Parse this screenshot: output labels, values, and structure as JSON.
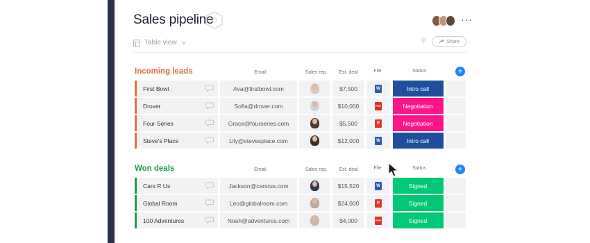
{
  "board": {
    "title": "Sales pipeline",
    "view_label": "Table view",
    "share_label": "Share",
    "more_label": "···"
  },
  "colors": {
    "sidebar": "#2b3147",
    "incoming_group": "#e2703a",
    "won_group": "#1f9b4f",
    "status_intro_call": "#1f4f9c",
    "status_negotiation": "#ff158a",
    "status_signed": "#00c875",
    "add_button": "#1f84ff"
  },
  "columns": {
    "email": "Email",
    "sales_rep": "Sales rep.",
    "est_deal": "Est. deal",
    "file": "File",
    "status": "Status"
  },
  "groups": [
    {
      "title": "Incoming leads",
      "rows": [
        {
          "name": "First Bowl",
          "email": "Ava@firstbowl.com",
          "deal": "$7,500",
          "file": "W",
          "file_type": "word-doc-icon",
          "status": "Intro call"
        },
        {
          "name": "Drover",
          "email": "Sofia@drover.com",
          "deal": "$10,000",
          "file": "PDF",
          "file_type": "pdf-icon",
          "status": "Negotiation"
        },
        {
          "name": "Four Series",
          "email": "Grace@fourseries.com",
          "deal": "$5,500",
          "file": "P",
          "file_type": "ppt-icon",
          "status": "Negotiation"
        },
        {
          "name": "Steve's Place",
          "email": "Lily@stevesplace.com",
          "deal": "$12,000",
          "file": "W",
          "file_type": "word-doc-icon",
          "status": "Intro call"
        }
      ]
    },
    {
      "title": "Won deals",
      "rows": [
        {
          "name": "Cars R Us",
          "email": "Jackson@carsrus.com",
          "deal": "$15,520",
          "file": "W",
          "file_type": "word-doc-icon",
          "status": "Signed"
        },
        {
          "name": "Global Room",
          "email": "Leo@globalroom.com",
          "deal": "$24,000",
          "file": "P",
          "file_type": "ppt-icon",
          "status": "Signed"
        },
        {
          "name": "100 Adventures",
          "email": "Noah@adventures.com",
          "deal": "$4,000",
          "file": "PDF",
          "file_type": "pdf-icon",
          "status": "Signed"
        }
      ]
    }
  ]
}
